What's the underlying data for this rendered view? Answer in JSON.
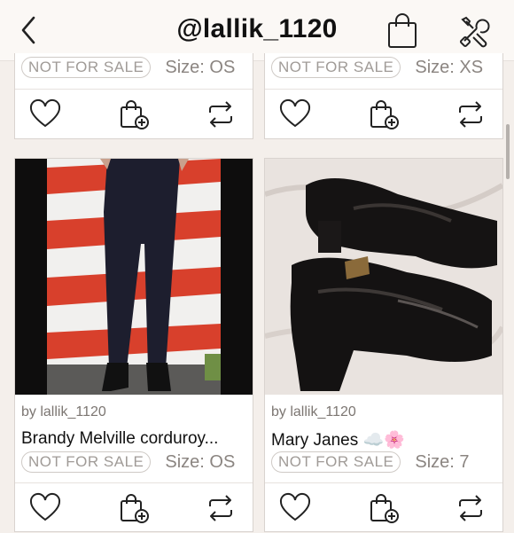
{
  "header": {
    "title": "@lallik_1120"
  },
  "listings_top": [
    {
      "status": "NOT FOR SALE",
      "size": "Size: OS"
    },
    {
      "status": "NOT FOR SALE",
      "size": "Size: XS"
    }
  ],
  "listings": [
    {
      "seller": "by lallik_1120",
      "title": "Brandy Melville corduroy...",
      "status": "NOT FOR SALE",
      "size": "Size: OS"
    },
    {
      "seller": "by lallik_1120",
      "title": "Mary Janes ☁️🌸",
      "status": "NOT FOR SALE",
      "size": "Size: 7"
    }
  ],
  "icons": {
    "back": "chevron-left-icon",
    "bag": "shopping-bag-icon",
    "tools": "tools-icon",
    "like": "heart-icon",
    "bundle": "bundle-add-icon",
    "share": "share-repost-icon"
  }
}
